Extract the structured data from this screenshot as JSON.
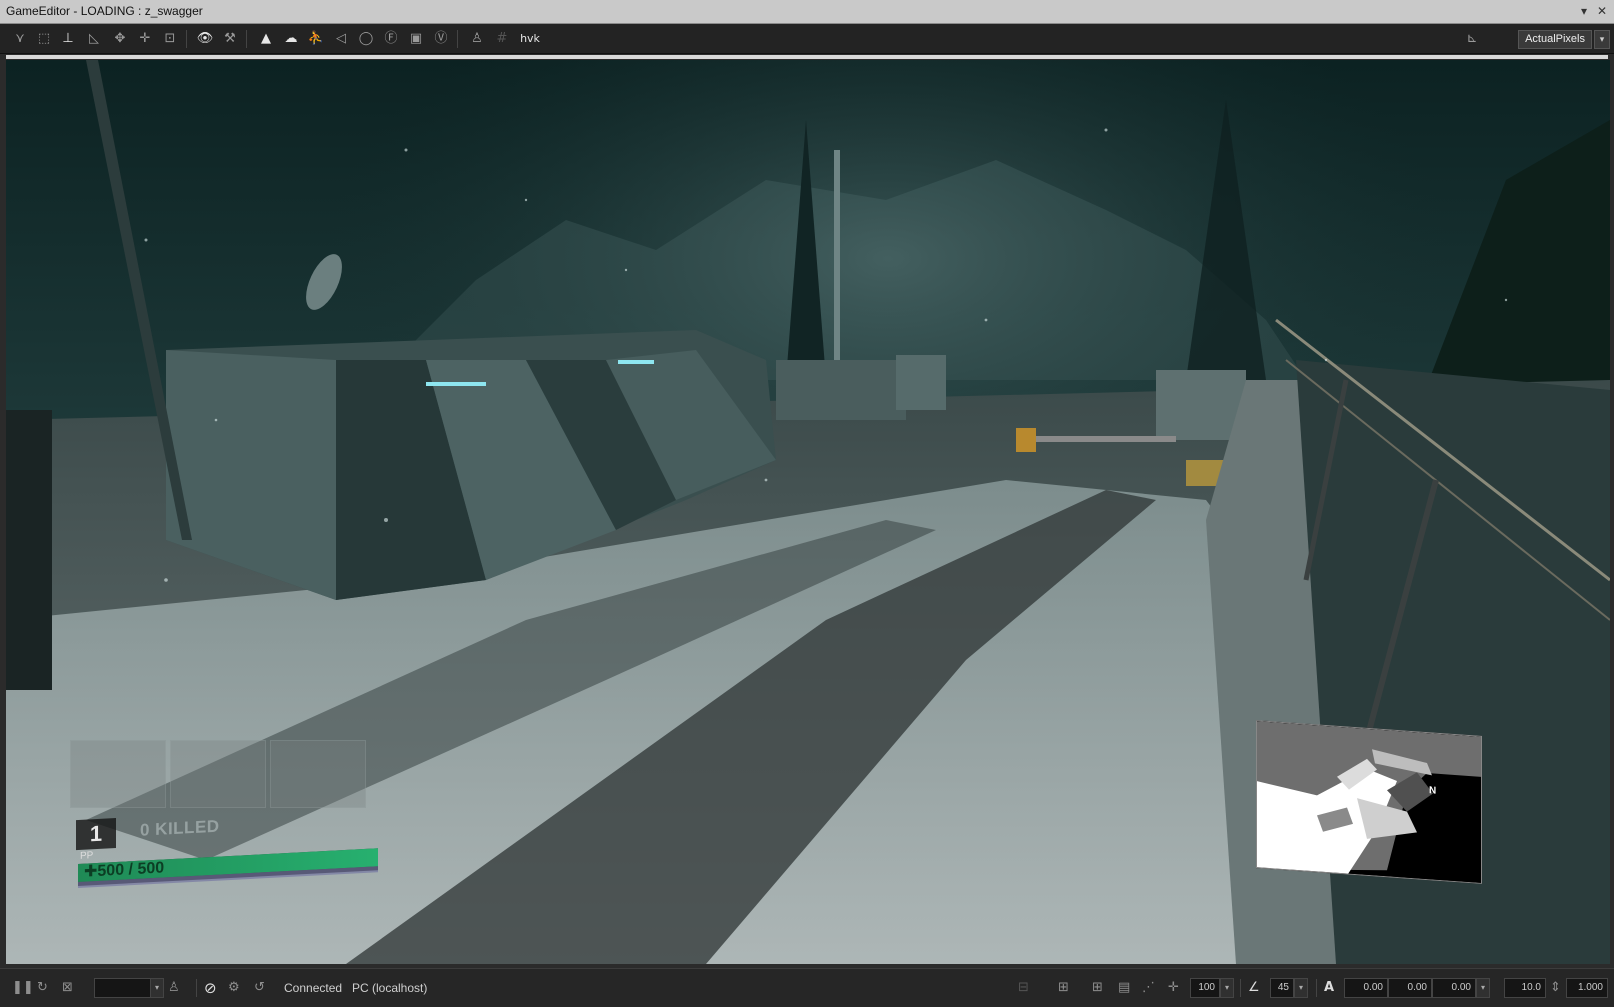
{
  "window": {
    "title": "GameEditor - LOADING : z_swagger",
    "controls": {
      "menu": "▾",
      "close": "✕"
    }
  },
  "toolbar": {
    "tools": [
      {
        "name": "select-tool-icon",
        "glyph": "⋎"
      },
      {
        "name": "marquee-tool-icon",
        "glyph": "⬚"
      },
      {
        "name": "axis-tool-icon",
        "glyph": "⊥"
      },
      {
        "name": "angle-tool-icon",
        "glyph": "◺"
      },
      {
        "name": "move-tool-icon",
        "glyph": "✥"
      },
      {
        "name": "pivot-tool-icon",
        "glyph": "✛"
      },
      {
        "name": "snap-tool-icon",
        "glyph": "⊡"
      },
      {
        "name": "eye-icon",
        "glyph": "👁"
      },
      {
        "name": "wrench-icon",
        "glyph": "⚒"
      },
      {
        "name": "tree-icon",
        "glyph": "▲"
      },
      {
        "name": "cloud-icon",
        "glyph": "☁"
      },
      {
        "name": "character-icon",
        "glyph": "⛹"
      },
      {
        "name": "sound-icon",
        "glyph": "◁"
      },
      {
        "name": "light-icon",
        "glyph": "◯"
      },
      {
        "name": "fx-icon",
        "glyph": "Ⓕ"
      },
      {
        "name": "window-icon",
        "glyph": "▣"
      },
      {
        "name": "volume-icon",
        "glyph": "Ⓥ"
      },
      {
        "name": "spawn-icon",
        "glyph": "♙"
      },
      {
        "name": "grid-icon",
        "glyph": "#"
      },
      {
        "name": "havok-icon",
        "glyph": "hvk"
      }
    ],
    "right_icon": "ruler-icon",
    "view_mode": "ActualPixels",
    "dropdown_glyph": "▾"
  },
  "hud": {
    "slot_number": "1",
    "killed_text": "0 KILLED",
    "pp_label": "PP",
    "health_text": "✚500 / 500",
    "health_fraction": 1.0
  },
  "minimap": {
    "north_label": "N"
  },
  "statusbar": {
    "pause_glyph": "❚❚",
    "refresh_glyph": "↻",
    "stop_glyph": "⊠",
    "frame_value": "",
    "connection_status": "Connected",
    "target": "PC (localhost)",
    "grid_size": "100",
    "angle_snap": "45",
    "coord_x": "0.00",
    "coord_y": "0.00",
    "coord_z": "0.00",
    "speed": "10.0",
    "scale": "1.000",
    "dropdown_glyph": "▾"
  }
}
